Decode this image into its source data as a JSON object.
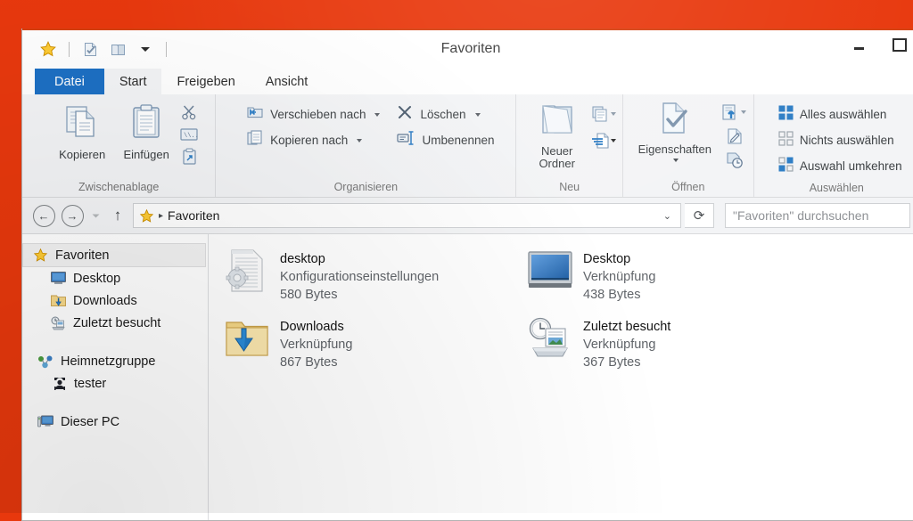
{
  "desktop": {
    "background_color": "#e8380d"
  },
  "window": {
    "title": "Favoriten",
    "accent_color": "#1d70c4",
    "quick_access": [
      {
        "name": "favorites-star",
        "icon": "star-icon"
      },
      {
        "name": "new-properties",
        "icon": "properties-icon"
      },
      {
        "name": "new-folder",
        "icon": "folder-icon"
      },
      {
        "name": "customize-dropdown",
        "icon": "chevron-down-icon"
      }
    ],
    "controls": {
      "minimize": "minimize-icon",
      "maximize": "maximize-icon"
    }
  },
  "tabs": [
    {
      "label": "Datei",
      "state": "file-menu"
    },
    {
      "label": "Start",
      "state": "active"
    },
    {
      "label": "Freigeben",
      "state": "normal"
    },
    {
      "label": "Ansicht",
      "state": "normal"
    }
  ],
  "ribbon": {
    "groups": [
      {
        "title": "Zwischenablage",
        "big_buttons": [
          {
            "label": "Kopieren",
            "icon": "copy-icon"
          },
          {
            "label": "Einfügen",
            "icon": "paste-icon"
          }
        ],
        "small_icons": [
          {
            "name": "cut-icon",
            "title": "Ausschneiden"
          },
          {
            "name": "copy-path-icon",
            "title": "Pfad kopieren"
          },
          {
            "name": "paste-shortcut-icon",
            "title": "Verknüpfung einfügen"
          }
        ]
      },
      {
        "title": "Organisieren",
        "small_buttons": [
          {
            "label": "Verschieben nach",
            "icon": "move-to-icon",
            "has_caret": true
          },
          {
            "label": "Kopieren nach",
            "icon": "copy-to-icon",
            "has_caret": true
          },
          {
            "label": "Löschen",
            "icon": "delete-icon",
            "has_caret": true
          },
          {
            "label": "Umbenennen",
            "icon": "rename-icon",
            "has_caret": false
          }
        ]
      },
      {
        "title": "Neu",
        "big_buttons": [
          {
            "label": "Neuer\nOrdner",
            "label_line1": "Neuer",
            "label_line2": "Ordner",
            "icon": "new-folder-icon"
          }
        ],
        "small_icons": [
          {
            "name": "new-item-icon",
            "has_caret": true
          },
          {
            "name": "easy-access-icon",
            "has_caret": true
          }
        ]
      },
      {
        "title": "Öffnen",
        "big_buttons": [
          {
            "label": "Eigenschaften",
            "icon": "properties-icon",
            "has_caret": true
          }
        ],
        "small_icons": [
          {
            "name": "open-with-icon",
            "has_caret": true
          },
          {
            "name": "edit-icon",
            "has_caret": false
          },
          {
            "name": "history-icon",
            "has_caret": false
          }
        ]
      },
      {
        "title": "Auswählen",
        "small_buttons": [
          {
            "label": "Alles auswählen",
            "icon": "select-all-icon"
          },
          {
            "label": "Nichts auswählen",
            "icon": "select-none-icon"
          },
          {
            "label": "Auswahl umkehren",
            "icon": "invert-selection-icon"
          }
        ]
      }
    ]
  },
  "addressbar": {
    "back": "back-icon",
    "forward": "forward-icon",
    "recent": "chevron-down-icon",
    "up": "up-arrow-icon",
    "breadcrumb_icon": "star-icon",
    "breadcrumb": "Favoriten",
    "breadcrumb_separator": "▸",
    "dropdown": "chevron-down-icon",
    "refresh": "refresh-icon",
    "search_placeholder": "\"Favoriten\" durchsuchen"
  },
  "navpane": {
    "items": [
      {
        "label": "Favoriten",
        "icon": "star-icon",
        "level": 0,
        "selected": true
      },
      {
        "label": "Desktop",
        "icon": "desktop-monitor-icon",
        "level": 1,
        "selected": false
      },
      {
        "label": "Downloads",
        "icon": "downloads-folder-icon",
        "level": 1,
        "selected": false
      },
      {
        "label": "Zuletzt besucht",
        "icon": "recent-places-icon",
        "level": 1,
        "selected": false
      },
      {
        "label": "Heimnetzgruppe",
        "icon": "homegroup-icon",
        "level": 0,
        "selected": false,
        "gap_before": true
      },
      {
        "label": "tester",
        "icon": "user-icon",
        "level": 1,
        "selected": false
      },
      {
        "label": "Dieser PC",
        "icon": "this-pc-icon",
        "level": 0,
        "selected": false,
        "gap_before": true
      }
    ]
  },
  "files": [
    {
      "name": "desktop",
      "type": "Konfigurationseinstellungen",
      "size": "580 Bytes",
      "icon": "config-file-icon"
    },
    {
      "name": "Desktop",
      "type": "Verknüpfung",
      "size": "438 Bytes",
      "icon": "desktop-monitor-icon"
    },
    {
      "name": "Downloads",
      "type": "Verknüpfung",
      "size": "867 Bytes",
      "icon": "downloads-folder-icon"
    },
    {
      "name": "Zuletzt besucht",
      "type": "Verknüpfung",
      "size": "367 Bytes",
      "icon": "recent-places-icon"
    }
  ]
}
